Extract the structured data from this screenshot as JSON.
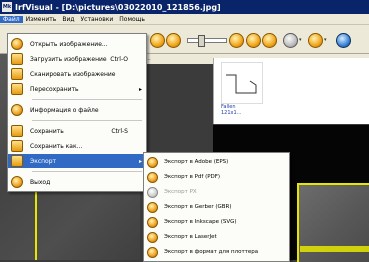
{
  "window": {
    "app_icon_text": "Mk",
    "title": "IrfVisual - [D:\\pictures\\03022010_121856.jpg]"
  },
  "menubar": [
    "Файл",
    "Изменить",
    "Вид",
    "Установки",
    "Помощь"
  ],
  "thumbnail": {
    "caption_line1": "Fallen",
    "caption_line2": "121x1..."
  },
  "tabstrip": {
    "label": "..."
  },
  "file_menu": {
    "items": [
      {
        "label": "Открыть изображение...",
        "shortcut": ""
      },
      {
        "label": "Загрузить изображение",
        "shortcut": "Ctrl-O"
      },
      {
        "label": "Сканировать изображение",
        "shortcut": ""
      },
      {
        "label": "Пересохранить",
        "shortcut": ""
      },
      {
        "label": "Информация о файле",
        "shortcut": ""
      },
      {
        "label": "Сохранить",
        "shortcut": "Ctrl-S"
      },
      {
        "label": "Сохранить как...",
        "shortcut": ""
      },
      {
        "label": "Экспорт",
        "shortcut": ""
      },
      {
        "label": "Выход",
        "shortcut": ""
      }
    ]
  },
  "export_menu": {
    "items": [
      {
        "label": "Экспорт в Adobe (EPS)",
        "disabled": false
      },
      {
        "label": "Экспорт в Pdf (PDF)",
        "disabled": false
      },
      {
        "label": "Экспорт PX",
        "disabled": true
      },
      {
        "label": "Экспорт в Gerber (GBR)",
        "disabled": false
      },
      {
        "label": "Экспорт в Inkscape (SVG)",
        "disabled": false
      },
      {
        "label": "Экспорт в LaserJet",
        "disabled": false
      },
      {
        "label": "Экспорт в формат для плоттера",
        "disabled": false
      }
    ]
  }
}
